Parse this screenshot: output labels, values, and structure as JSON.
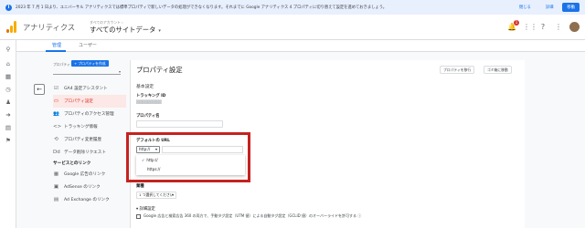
{
  "banner": {
    "message": "2023 年 7 月 1 日より、ユニバーサル アナリティクスでは標準プロパティで新しいデータの処理ができなくなります。それまでに Google アナリティクス 4 プロパティに切り替えて設定を進めておきましょう。",
    "close": "閉じる",
    "details": "詳細",
    "migrate": "移動"
  },
  "header": {
    "app_title": "アナリティクス",
    "breadcrumb": "すべてのアカウント ›",
    "view": "すべてのサイトデータ",
    "notification_count": "1"
  },
  "tabs": {
    "admin": "管理",
    "user": "ユーザー"
  },
  "property": {
    "label": "プロパティ",
    "create_button": "+ プロパティを作成"
  },
  "nav": {
    "items": [
      {
        "icon": "☑",
        "label": "GA4 設定アシスタント"
      },
      {
        "icon": "▭",
        "label": "プロパティ設定"
      },
      {
        "icon": "👥",
        "label": "プロパティのアクセス管理"
      },
      {
        "icon": "<>",
        "label": "トラッキング情報"
      },
      {
        "icon": "⟲",
        "label": "プロパティ変更履歴"
      },
      {
        "icon": "Dd",
        "label": "データ削除リクエスト"
      }
    ],
    "section": "サービスとのリンク",
    "links": [
      {
        "icon": "▦",
        "label": "Google 広告のリンク"
      },
      {
        "icon": "▣",
        "label": "AdSense のリンク"
      },
      {
        "icon": "▤",
        "label": "Ad Exchange のリンク"
      }
    ]
  },
  "panel": {
    "title": "プロパティ設定",
    "trash_button": "プロパティを移行",
    "move_button": "ゴミ箱に移動",
    "basic_settings": "基本設定",
    "tracking_id_label": "トラッキング ID",
    "property_name_label": "プロパティ名",
    "default_url_label": "デフォルトの URL",
    "protocol_selected": "http://",
    "protocol_options": [
      "http://",
      "https://"
    ],
    "industry_label": "業種",
    "industry_placeholder": "1 つ選択してください",
    "advanced_settings": "▾ 詳細設定",
    "advanced_checkbox": "Google 広告と検索広告 360 の両方で、手動タグ設定（UTM 値）による自動タグ設定（GCLID 値）のオーバーライドを許可する ⓘ"
  }
}
